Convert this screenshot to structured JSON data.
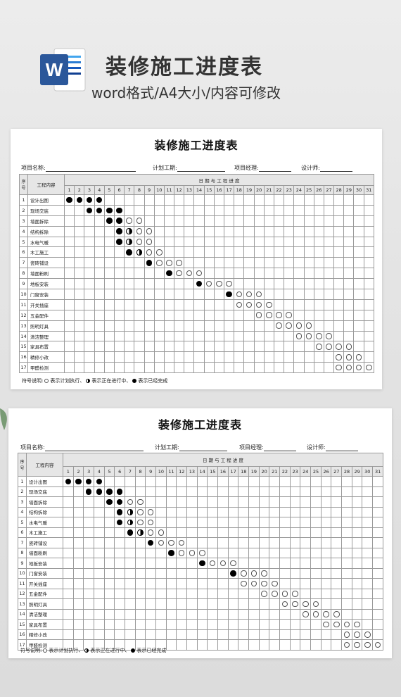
{
  "hero": {
    "title": "装修施工进度表",
    "subtitle": "word格式/A4大小/内容可修改",
    "icon_letter": "W"
  },
  "sheet": {
    "title": "装修施工进度表",
    "fields": [
      "项目名称:",
      "计划工期:",
      "项目经理:",
      "设计师:"
    ],
    "col_seq": "序号",
    "col_task": "工程内容",
    "date_header": "日 期 与 工 程 进 度",
    "days": [
      1,
      2,
      3,
      4,
      5,
      6,
      7,
      8,
      9,
      10,
      11,
      12,
      13,
      14,
      15,
      16,
      17,
      18,
      19,
      20,
      21,
      22,
      23,
      24,
      25,
      26,
      27,
      28,
      29,
      30,
      31
    ],
    "tasks": [
      {
        "no": "1",
        "name": "设计出图",
        "marks": {
          "1": "done",
          "2": "done",
          "3": "done",
          "4": "done"
        }
      },
      {
        "no": "2",
        "name": "现场交底",
        "marks": {
          "3": "done",
          "4": "done",
          "5": "done",
          "6": "done"
        }
      },
      {
        "no": "3",
        "name": "墙面拆除",
        "marks": {
          "5": "done",
          "6": "done",
          "7": "plan",
          "8": "plan"
        }
      },
      {
        "no": "4",
        "name": "结构拆除",
        "marks": {
          "6": "done",
          "7": "half",
          "8": "plan",
          "9": "plan"
        }
      },
      {
        "no": "5",
        "name": "水电气暖",
        "marks": {
          "6": "done",
          "7": "half",
          "8": "plan",
          "9": "plan"
        }
      },
      {
        "no": "6",
        "name": "木工施工",
        "marks": {
          "7": "done",
          "8": "half",
          "9": "plan",
          "10": "plan"
        }
      },
      {
        "no": "7",
        "name": "瓷砖铺设",
        "marks": {
          "9": "done",
          "10": "plan",
          "11": "plan",
          "12": "plan"
        }
      },
      {
        "no": "8",
        "name": "墙面粉刷",
        "marks": {
          "11": "done",
          "12": "plan",
          "13": "plan",
          "14": "plan"
        }
      },
      {
        "no": "9",
        "name": "地板安装",
        "marks": {
          "14": "done",
          "15": "plan",
          "16": "plan",
          "17": "plan"
        }
      },
      {
        "no": "10",
        "name": "门窗安装",
        "marks": {
          "17": "done",
          "18": "plan",
          "19": "plan",
          "20": "plan"
        }
      },
      {
        "no": "11",
        "name": "开关插座",
        "marks": {
          "18": "plan",
          "19": "plan",
          "20": "plan",
          "21": "plan"
        }
      },
      {
        "no": "12",
        "name": "五金配件",
        "marks": {
          "20": "plan",
          "21": "plan",
          "22": "plan",
          "23": "plan"
        }
      },
      {
        "no": "13",
        "name": "照明灯具",
        "marks": {
          "22": "plan",
          "23": "plan",
          "24": "plan",
          "25": "plan"
        }
      },
      {
        "no": "14",
        "name": "清洁整理",
        "marks": {
          "24": "plan",
          "25": "plan",
          "26": "plan",
          "27": "plan"
        }
      },
      {
        "no": "15",
        "name": "家具布置",
        "marks": {
          "26": "plan",
          "27": "plan",
          "28": "plan",
          "29": "plan"
        }
      },
      {
        "no": "16",
        "name": "精修小改",
        "marks": {
          "28": "plan",
          "29": "plan",
          "30": "plan"
        }
      },
      {
        "no": "17",
        "name": "甲醛检测",
        "marks": {
          "28": "plan",
          "29": "plan",
          "30": "plan",
          "31": "plan"
        }
      }
    ],
    "legend": {
      "label": "符号说明:",
      "plan": "表示计划执行",
      "half": "表示正在进行中",
      "done": "表示已经完成",
      "sep": "、"
    }
  },
  "colors": {
    "word_blue": "#2b579a",
    "header_gray": "#e6e6e6"
  }
}
